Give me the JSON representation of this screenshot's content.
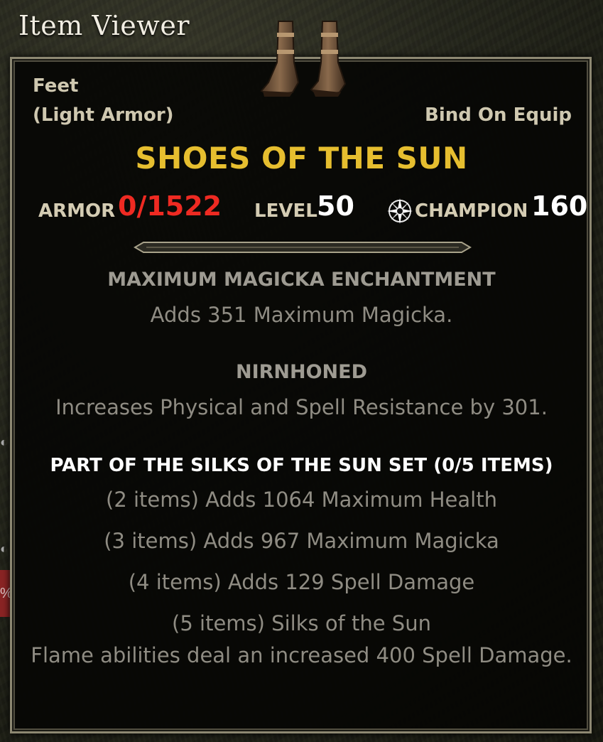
{
  "window": {
    "title": "Item Viewer"
  },
  "item": {
    "slot": "Feet",
    "armor_type": "(Light Armor)",
    "bind": "Bind On Equip",
    "name": "SHOES OF THE SUN",
    "icon": "boots-icon"
  },
  "stats": {
    "armor_label": "ARMOR",
    "armor_value": "0/1522",
    "level_label": "LEVEL",
    "level_value": "50",
    "champion_icon": "champion-star-icon",
    "champion_label": "CHAMPION",
    "champion_value": "160"
  },
  "enchantment": {
    "title": "MAXIMUM MAGICKA ENCHANTMENT",
    "description": "Adds 351 Maximum Magicka."
  },
  "trait": {
    "title": "NIRNHONED",
    "description": "Increases Physical and Spell Resistance by 301."
  },
  "set": {
    "title": "PART OF THE SILKS OF THE SUN SET (0/5 ITEMS)",
    "bonuses": [
      "(2 items) Adds 1064 Maximum Health",
      "(3 items) Adds 967 Maximum Magicka",
      "(4 items) Adds 129 Spell Damage",
      "(5 items) Silks of the Sun"
    ],
    "bonus_5_description": "Flame abilities deal an increased 400 Spell Damage."
  },
  "colors": {
    "item_name": "#e6be2f",
    "armor_value": "#ee2a22",
    "panel_border": "#8d8872"
  }
}
